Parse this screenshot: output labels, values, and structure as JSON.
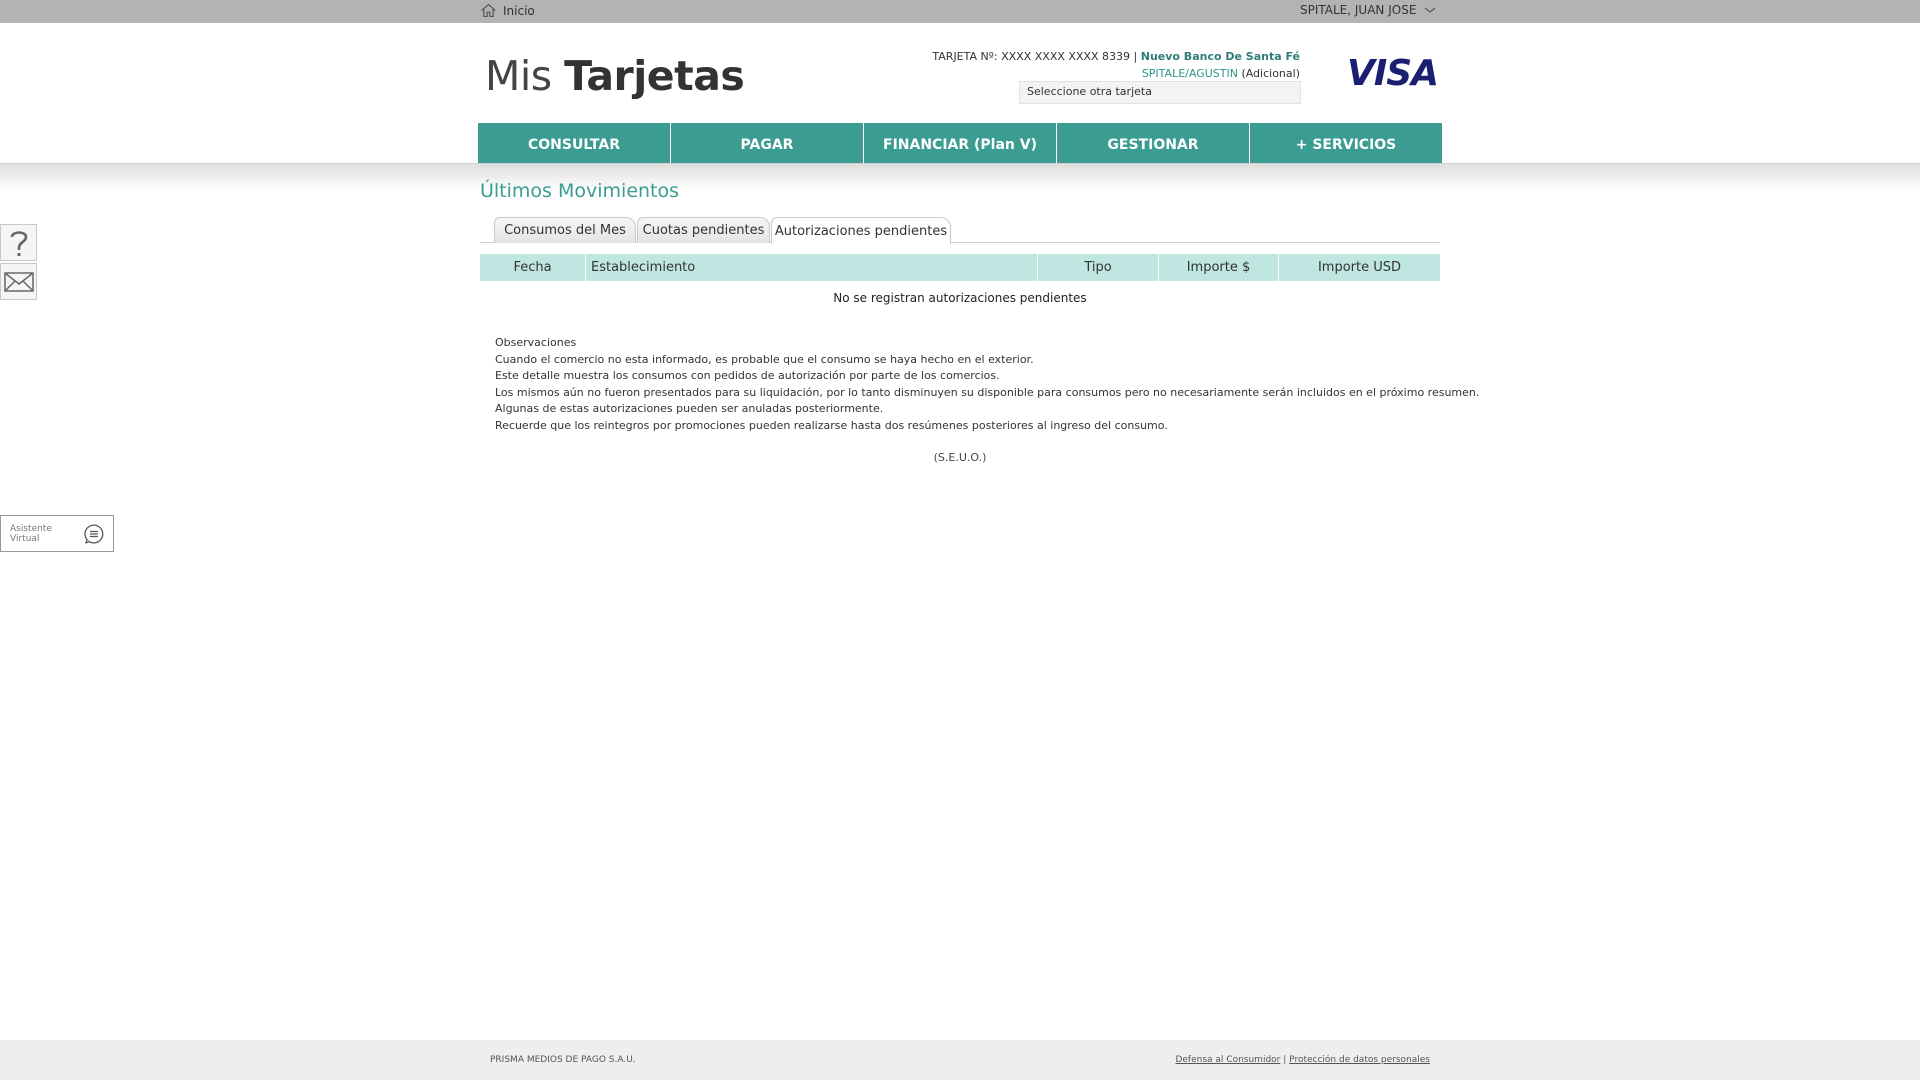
{
  "topbar": {
    "home_label": "Inicio",
    "user_name": "SPITALE, JUAN JOSE"
  },
  "header": {
    "logo_light": "Mis ",
    "logo_bold": "Tarjetas",
    "card_number": "TARJETA Nº: XXXX XXXX XXXX 8339 |",
    "bank_name": "Nuevo Banco De Santa Fé",
    "holder": "SPITALE/AGUSTIN",
    "holder_type": "(Adicional)",
    "card_select": "Seleccione otra tarjeta",
    "brand": "VISA"
  },
  "nav": {
    "items": [
      {
        "label": "CONSULTAR"
      },
      {
        "label": "PAGAR"
      },
      {
        "label": "FINANCIAR (Plan V)"
      },
      {
        "label": "GESTIONAR"
      },
      {
        "label": "+ SERVICIOS"
      }
    ]
  },
  "side": {
    "assistant_label": "Asistente Virtual"
  },
  "content": {
    "title": "Últimos Movimientos",
    "tabs": [
      {
        "label": "Consumos del Mes"
      },
      {
        "label": "Cuotas pendientes"
      },
      {
        "label": "Autorizaciones pendientes"
      }
    ],
    "active_tab": "Autorizaciones pendientes",
    "table": {
      "columns": [
        "Fecha",
        "Establecimiento",
        "Tipo",
        "Importe $",
        "Importe USD"
      ],
      "empty_message": "No se registran autorizaciones pendientes"
    },
    "observaciones": {
      "title": "Observaciones",
      "lines": [
        "Cuando el comercio no esta informado, es probable que el consumo se haya hecho en el exterior.",
        "Este detalle muestra los consumos con pedidos de autorización por parte de los comercios.",
        "Los mismos aún no fueron presentados para su liquidación, por lo tanto disminuyen su disponible para consumos pero no necesariamente serán incluidos en el próximo resumen.",
        "Algunas de estas autorizaciones pueden ser anuladas posteriormente.",
        "Recuerde que los reintegros por promociones pueden realizarse hasta dos resúmenes posteriores al ingreso del consumo."
      ]
    },
    "seuo": "(S.E.U.O.)"
  },
  "footer": {
    "company": "PRISMA MEDIOS DE PAGO S.A.U.",
    "link_consumer": "Defensa al Consumidor",
    "separator": "|",
    "link_privacy": "Protección de datos personales"
  },
  "colors": {
    "accent": "#3b9c91",
    "table_header": "#bfe6e1",
    "visa_blue": "#1a1f71"
  }
}
